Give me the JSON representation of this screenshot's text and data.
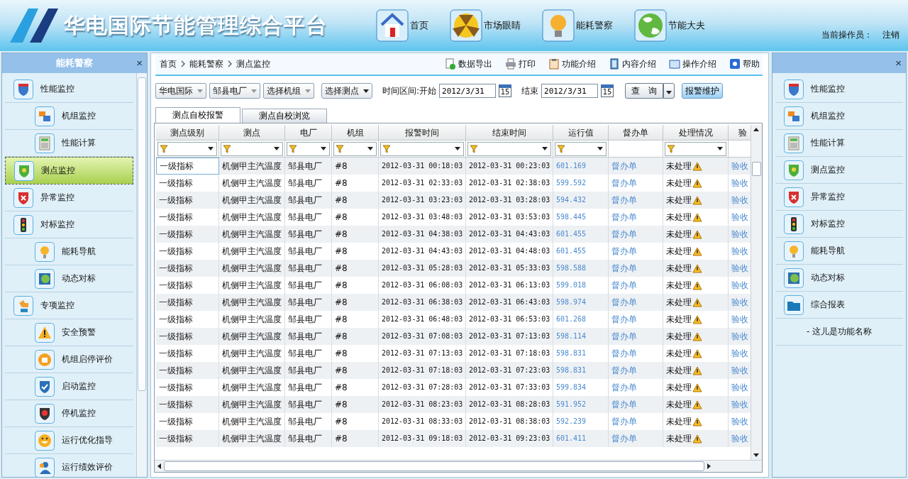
{
  "header": {
    "title": "华电国际节能管理综合平台",
    "nav": [
      {
        "label": "首页"
      },
      {
        "label": "市场眼睛"
      },
      {
        "label": "能耗警察"
      },
      {
        "label": "节能大夫"
      }
    ],
    "operator_label": "当前操作员：",
    "logout": "注销"
  },
  "left_panel": {
    "title": "能耗警察",
    "close": "×",
    "items": [
      {
        "label": "性能监控",
        "selected": false,
        "children": [
          {
            "label": "机组监控",
            "selected": false
          },
          {
            "label": "性能计算",
            "selected": false
          }
        ]
      },
      {
        "label": "测点监控",
        "selected": true
      },
      {
        "label": "异常监控",
        "selected": false
      },
      {
        "label": "对标监控",
        "selected": false,
        "children": [
          {
            "label": "能耗导航",
            "selected": false
          },
          {
            "label": "动态对标",
            "selected": false
          }
        ]
      },
      {
        "label": "专项监控",
        "selected": false,
        "children": [
          {
            "label": "安全预警",
            "selected": false
          },
          {
            "label": "机组启停评价",
            "selected": false
          },
          {
            "label": "启动监控",
            "selected": false
          },
          {
            "label": "停机监控",
            "selected": false
          },
          {
            "label": "运行优化指导",
            "selected": false
          },
          {
            "label": "运行绩效评价",
            "selected": false
          }
        ]
      }
    ]
  },
  "breadcrumb": [
    "首页",
    "能耗警察",
    "测点监控"
  ],
  "actions": [
    {
      "label": "数据导出"
    },
    {
      "label": "打印"
    },
    {
      "label": "功能介绍"
    },
    {
      "label": "内容介绍"
    },
    {
      "label": "操作介绍"
    },
    {
      "label": "帮助"
    }
  ],
  "filters": {
    "company": "华电国际",
    "plant": "邹县电厂",
    "unit": "选择机组",
    "point": "选择测点",
    "range_label": "时间区间:开始",
    "start": {
      "value": "2012/3/31",
      "calendar_day": "15"
    },
    "end_label": "结束",
    "end": {
      "value": "2012/3/31",
      "calendar_day": "15"
    },
    "query": "查　询",
    "maintain": "报警维护"
  },
  "tabs": [
    {
      "label": "测点自校报警",
      "selected": true
    },
    {
      "label": "测点自校浏览",
      "selected": false
    }
  ],
  "table": {
    "columns": [
      {
        "label": "测点级别",
        "filter": true
      },
      {
        "label": "测点",
        "filter": true
      },
      {
        "label": "电厂",
        "filter": true
      },
      {
        "label": "机组",
        "filter": true
      },
      {
        "label": "报警时间",
        "filter": true
      },
      {
        "label": "结束时间",
        "filter": true
      },
      {
        "label": "运行值",
        "filter": true
      },
      {
        "label": "督办单",
        "filter": false
      },
      {
        "label": "处理情况",
        "filter": true
      },
      {
        "label": "验",
        "filter": false
      }
    ],
    "rows": [
      {
        "selected": true,
        "cells": [
          "一级指标",
          "机侧甲主汽温度",
          "邹县电厂",
          "#8",
          "2012-03-31 00:18:03",
          "2012-03-31 00:23:03",
          "601.169",
          "督办单",
          "未处理",
          "验收"
        ]
      },
      {
        "selected": false,
        "cells": [
          "一级指标",
          "机侧甲主汽温度",
          "邹县电厂",
          "#8",
          "2012-03-31 02:33:03",
          "2012-03-31 02:38:03",
          "599.592",
          "督办单",
          "未处理",
          "验收"
        ]
      },
      {
        "selected": false,
        "cells": [
          "一级指标",
          "机侧甲主汽温度",
          "邹县电厂",
          "#8",
          "2012-03-31 03:23:03",
          "2012-03-31 03:28:03",
          "594.432",
          "督办单",
          "未处理",
          "验收"
        ]
      },
      {
        "selected": false,
        "cells": [
          "一级指标",
          "机侧甲主汽温度",
          "邹县电厂",
          "#8",
          "2012-03-31 03:48:03",
          "2012-03-31 03:53:03",
          "598.445",
          "督办单",
          "未处理",
          "验收"
        ]
      },
      {
        "selected": false,
        "cells": [
          "一级指标",
          "机侧甲主汽温度",
          "邹县电厂",
          "#8",
          "2012-03-31 04:38:03",
          "2012-03-31 04:43:03",
          "601.455",
          "督办单",
          "未处理",
          "验收"
        ]
      },
      {
        "selected": false,
        "cells": [
          "一级指标",
          "机侧甲主汽温度",
          "邹县电厂",
          "#8",
          "2012-03-31 04:43:03",
          "2012-03-31 04:48:03",
          "601.455",
          "督办单",
          "未处理",
          "验收"
        ]
      },
      {
        "selected": false,
        "cells": [
          "一级指标",
          "机侧甲主汽温度",
          "邹县电厂",
          "#8",
          "2012-03-31 05:28:03",
          "2012-03-31 05:33:03",
          "598.588",
          "督办单",
          "未处理",
          "验收"
        ]
      },
      {
        "selected": false,
        "cells": [
          "一级指标",
          "机侧甲主汽温度",
          "邹县电厂",
          "#8",
          "2012-03-31 06:08:03",
          "2012-03-31 06:13:03",
          "599.018",
          "督办单",
          "未处理",
          "验收"
        ]
      },
      {
        "selected": false,
        "cells": [
          "一级指标",
          "机侧甲主汽温度",
          "邹县电厂",
          "#8",
          "2012-03-31 06:38:03",
          "2012-03-31 06:43:03",
          "598.974",
          "督办单",
          "未处理",
          "验收"
        ]
      },
      {
        "selected": false,
        "cells": [
          "一级指标",
          "机侧甲主汽温度",
          "邹县电厂",
          "#8",
          "2012-03-31 06:48:03",
          "2012-03-31 06:53:03",
          "601.268",
          "督办单",
          "未处理",
          "验收"
        ]
      },
      {
        "selected": false,
        "cells": [
          "一级指标",
          "机侧甲主汽温度",
          "邹县电厂",
          "#8",
          "2012-03-31 07:08:03",
          "2012-03-31 07:13:03",
          "598.114",
          "督办单",
          "未处理",
          "验收"
        ]
      },
      {
        "selected": false,
        "cells": [
          "一级指标",
          "机侧甲主汽温度",
          "邹县电厂",
          "#8",
          "2012-03-31 07:13:03",
          "2012-03-31 07:18:03",
          "598.831",
          "督办单",
          "未处理",
          "验收"
        ]
      },
      {
        "selected": false,
        "cells": [
          "一级指标",
          "机侧甲主汽温度",
          "邹县电厂",
          "#8",
          "2012-03-31 07:18:03",
          "2012-03-31 07:23:03",
          "598.831",
          "督办单",
          "未处理",
          "验收"
        ]
      },
      {
        "selected": false,
        "cells": [
          "一级指标",
          "机侧甲主汽温度",
          "邹县电厂",
          "#8",
          "2012-03-31 07:28:03",
          "2012-03-31 07:33:03",
          "599.834",
          "督办单",
          "未处理",
          "验收"
        ]
      },
      {
        "selected": false,
        "cells": [
          "一级指标",
          "机侧甲主汽温度",
          "邹县电厂",
          "#8",
          "2012-03-31 08:23:03",
          "2012-03-31 08:28:03",
          "591.952",
          "督办单",
          "未处理",
          "验收"
        ]
      },
      {
        "selected": false,
        "cells": [
          "一级指标",
          "机侧甲主汽温度",
          "邹县电厂",
          "#8",
          "2012-03-31 08:33:03",
          "2012-03-31 08:38:03",
          "592.239",
          "督办单",
          "未处理",
          "验收"
        ]
      },
      {
        "selected": false,
        "cells": [
          "一级指标",
          "机侧甲主汽温度",
          "邹县电厂",
          "#8",
          "2012-03-31 09:18:03",
          "2012-03-31 09:23:03",
          "601.411",
          "督办单",
          "未处理",
          "验收"
        ]
      }
    ]
  },
  "right_panel": {
    "close": "×",
    "items": [
      {
        "kind": "link",
        "label": "性能监控"
      },
      {
        "kind": "link",
        "label": "机组监控"
      },
      {
        "kind": "link",
        "label": "性能计算"
      },
      {
        "kind": "link",
        "label": "测点监控"
      },
      {
        "kind": "link",
        "label": "异常监控"
      },
      {
        "kind": "link",
        "label": "对标监控"
      },
      {
        "kind": "link",
        "label": "能耗导航"
      },
      {
        "kind": "link",
        "label": "动态对标"
      },
      {
        "kind": "link",
        "label": "综合报表"
      },
      {
        "kind": "note",
        "label": "-  这儿是功能名称"
      }
    ]
  }
}
